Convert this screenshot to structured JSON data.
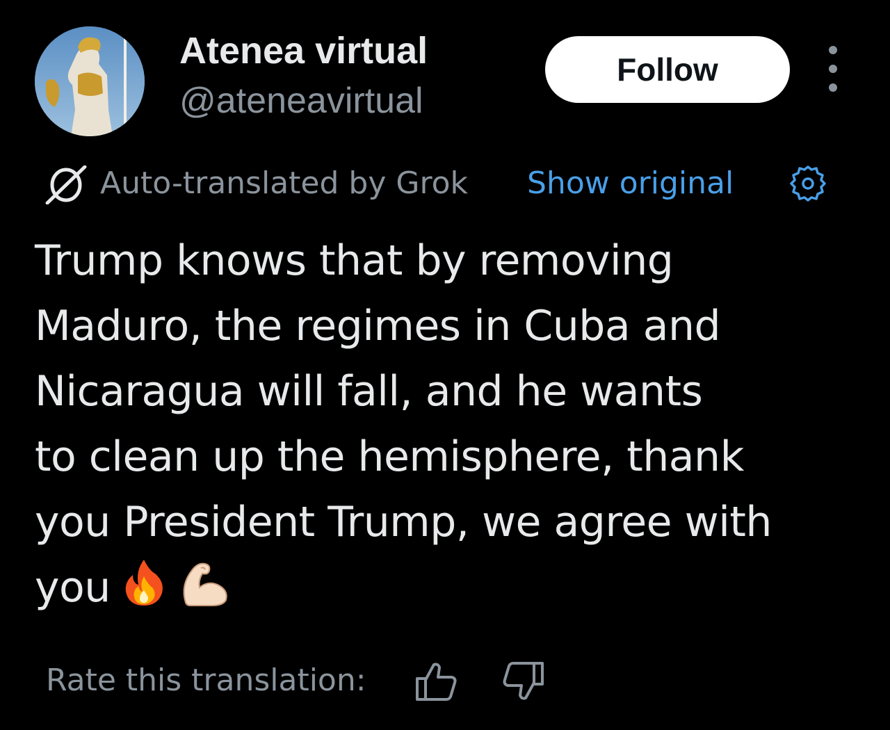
{
  "author": {
    "display_name": "Atenea virtual",
    "handle": "@ateneavirtual",
    "avatar_icon": "athena-statue-avatar"
  },
  "actions": {
    "follow_label": "Follow",
    "more_icon": "more-vertical-icon"
  },
  "translation": {
    "icon": "grok-icon",
    "label": "Auto-translated by Grok",
    "show_original_label": "Show original",
    "settings_icon": "gear-icon"
  },
  "post": {
    "lines": [
      "Trump knows that by removing",
      "Maduro, the regimes in Cuba and",
      "Nicaragua will fall, and he wants",
      "to clean up the hemisphere, thank",
      "you President Trump, we agree with",
      "you"
    ],
    "emojis": [
      "fire-emoji",
      "flexed-biceps-emoji"
    ]
  },
  "rating": {
    "label": "Rate this translation:",
    "thumbs_up_icon": "thumbs-up-icon",
    "thumbs_down_icon": "thumbs-down-icon"
  },
  "colors": {
    "background": "#000000",
    "primary_text": "#e7e9ea",
    "secondary_text": "#8b949c",
    "link": "#4a9fe8",
    "follow_bg": "#ffffff"
  }
}
